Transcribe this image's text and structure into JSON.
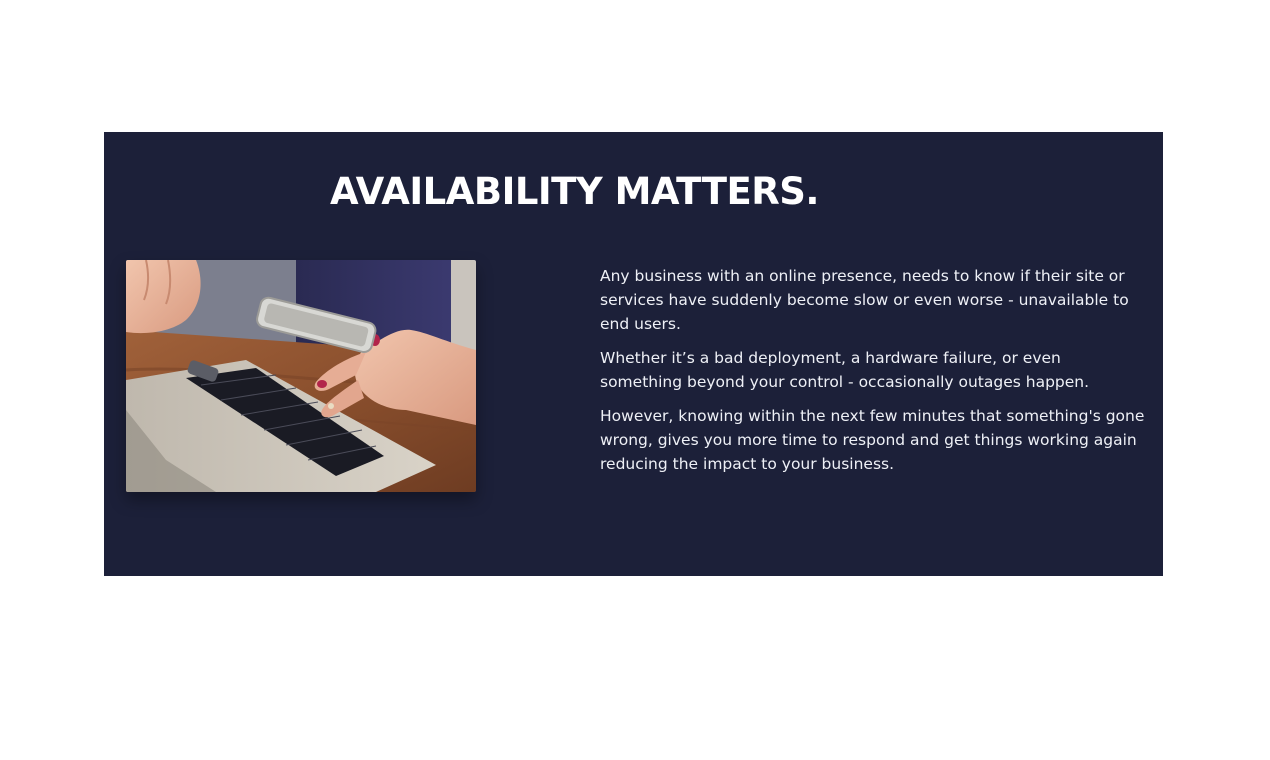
{
  "section": {
    "heading": "AVAILABILITY MATTERS.",
    "paragraphs": [
      "Any business with an online presence, needs to know if their site or services have suddenly become slow or even worse - unavailable to end users.",
      "Whether it’s a bad deployment, a hardware failure, or even something beyond your control - occasionally outages happen.",
      "However, knowing within the next few minutes that something's gone wrong, gives you more time to respond and get things working again reducing the impact to your business."
    ],
    "image": {
      "subject": "person-holding-phone-over-laptop-photo"
    }
  },
  "colors": {
    "page_background": "#ffffff",
    "banner_background": "#1c2039",
    "heading_text": "#ffffff",
    "body_text": "#eef0f6"
  }
}
